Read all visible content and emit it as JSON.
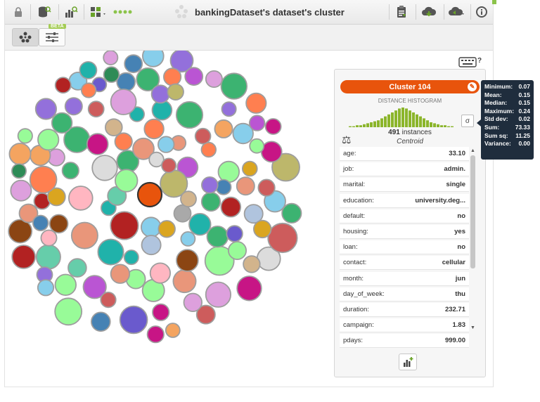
{
  "window": {
    "title": "bankingDataset's dataset's cluster"
  },
  "toolbar": {
    "left_icons": [
      "lock-icon",
      "dataset-search-icon",
      "bar-chart-search-icon",
      "model-split-icon"
    ],
    "right_icons": [
      "report-icon",
      "cloud-download-icon",
      "cloud-sync-icon",
      "info-icon"
    ]
  },
  "modes": {
    "beta_label": "BETA"
  },
  "panel": {
    "cluster_name": "Cluster 104",
    "histogram_label": "DISTANCE HISTOGRAM",
    "instances_count": "491",
    "instances_word": " instances",
    "centroid_label": "Centroid",
    "histogram_values": [
      1,
      1,
      2,
      2,
      3,
      4,
      5,
      6,
      7,
      9,
      11,
      13,
      15,
      17,
      19,
      20,
      19,
      17,
      15,
      13,
      11,
      9,
      7,
      5,
      4,
      3,
      2,
      2,
      1,
      1
    ],
    "fields": [
      {
        "name": "age:",
        "value": "33.10"
      },
      {
        "name": "job:",
        "value": "admin."
      },
      {
        "name": "marital:",
        "value": "single"
      },
      {
        "name": "education:",
        "value": "university.deg..."
      },
      {
        "name": "default:",
        "value": "no"
      },
      {
        "name": "housing:",
        "value": "yes"
      },
      {
        "name": "loan:",
        "value": "no"
      },
      {
        "name": "contact:",
        "value": "cellular"
      },
      {
        "name": "month:",
        "value": "jun"
      },
      {
        "name": "day_of_week:",
        "value": "thu"
      },
      {
        "name": "duration:",
        "value": "232.71"
      },
      {
        "name": "campaign:",
        "value": "1.83"
      },
      {
        "name": "pdays:",
        "value": "999.00"
      }
    ],
    "sigma_label": "σ"
  },
  "stats_tooltip": [
    {
      "label": "Minimum:",
      "value": "0.07"
    },
    {
      "label": "Mean:",
      "value": "0.15"
    },
    {
      "label": "Median:",
      "value": "0.15"
    },
    {
      "label": "Maximum:",
      "value": "0.24"
    },
    {
      "label": "Std dev:",
      "value": "0.02"
    },
    {
      "label": "Sum:",
      "value": "73.33"
    },
    {
      "label": "Sum sq:",
      "value": "11.25"
    },
    {
      "label": "Variance:",
      "value": "0.00"
    }
  ],
  "colors": {
    "accent": "#e8540c",
    "tooltip_bg": "#1f2d3d",
    "histogram_bar": "#8bb52b",
    "cluster_palette": [
      "#f4a460",
      "#9370db",
      "#66cdaa",
      "#dda0dd",
      "#87ceeb",
      "#bdb76b",
      "#d2b48c",
      "#98fb98",
      "#ffb6c1",
      "#b0c4de",
      "#cd5c5c",
      "#20b2aa",
      "#ff7f50",
      "#6a5acd",
      "#3cb371",
      "#daa520",
      "#a9a9a9",
      "#8b4513",
      "#b22222",
      "#c71585",
      "#4682b4",
      "#2e8b57",
      "#e9967a",
      "#ba55d3",
      "#dcdcdc"
    ]
  }
}
